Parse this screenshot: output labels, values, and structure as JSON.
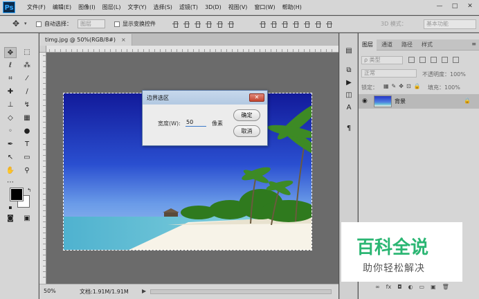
{
  "app": {
    "logo": "Ps"
  },
  "menu": [
    "文件(F)",
    "编辑(E)",
    "图像(I)",
    "图层(L)",
    "文字(Y)",
    "选择(S)",
    "滤镜(T)",
    "3D(D)",
    "视图(V)",
    "窗口(W)",
    "帮助(H)"
  ],
  "window_controls": {
    "minimize": "—",
    "restore": "□",
    "close": "✕"
  },
  "options": {
    "auto_select_label": "自动选择：",
    "auto_select_value": "图层",
    "show_transform_label": "显示变换控件",
    "mode_3d_label": "3D 模式：",
    "workspace": "基本功能"
  },
  "document": {
    "tab_title": "timg.jpg @ 50%(RGB/8#)",
    "tab_close": "×",
    "zoom": "50%",
    "doc_info": "文档:1.91M/1.91M",
    "status_arrow": "▶"
  },
  "dialog": {
    "title": "边界选区",
    "close": "✕",
    "width_label": "宽度(W):",
    "width_value": "50",
    "unit": "像素",
    "ok": "确定",
    "cancel": "取消"
  },
  "layers_panel": {
    "tabs": [
      "图层",
      "通道",
      "路径",
      "样式"
    ],
    "filter_kind": "ρ 类型",
    "blend_mode": "正常",
    "opacity_label": "不透明度：100%",
    "lock_label": "锁定：",
    "fill_label": "填充：100%",
    "layer_name": "背景",
    "bottom_icons": [
      "∞",
      "fx",
      "◘",
      "◐",
      "▭",
      "▣",
      "🗑"
    ]
  },
  "watermark": {
    "main": "百科全说",
    "sub": "助你轻松解决"
  },
  "colors": {
    "panel": "#d6d6d6",
    "canvas_bg": "#6b6b6b",
    "watermark_green": "#2bb673",
    "dialog_accent": "#3a79c9"
  }
}
